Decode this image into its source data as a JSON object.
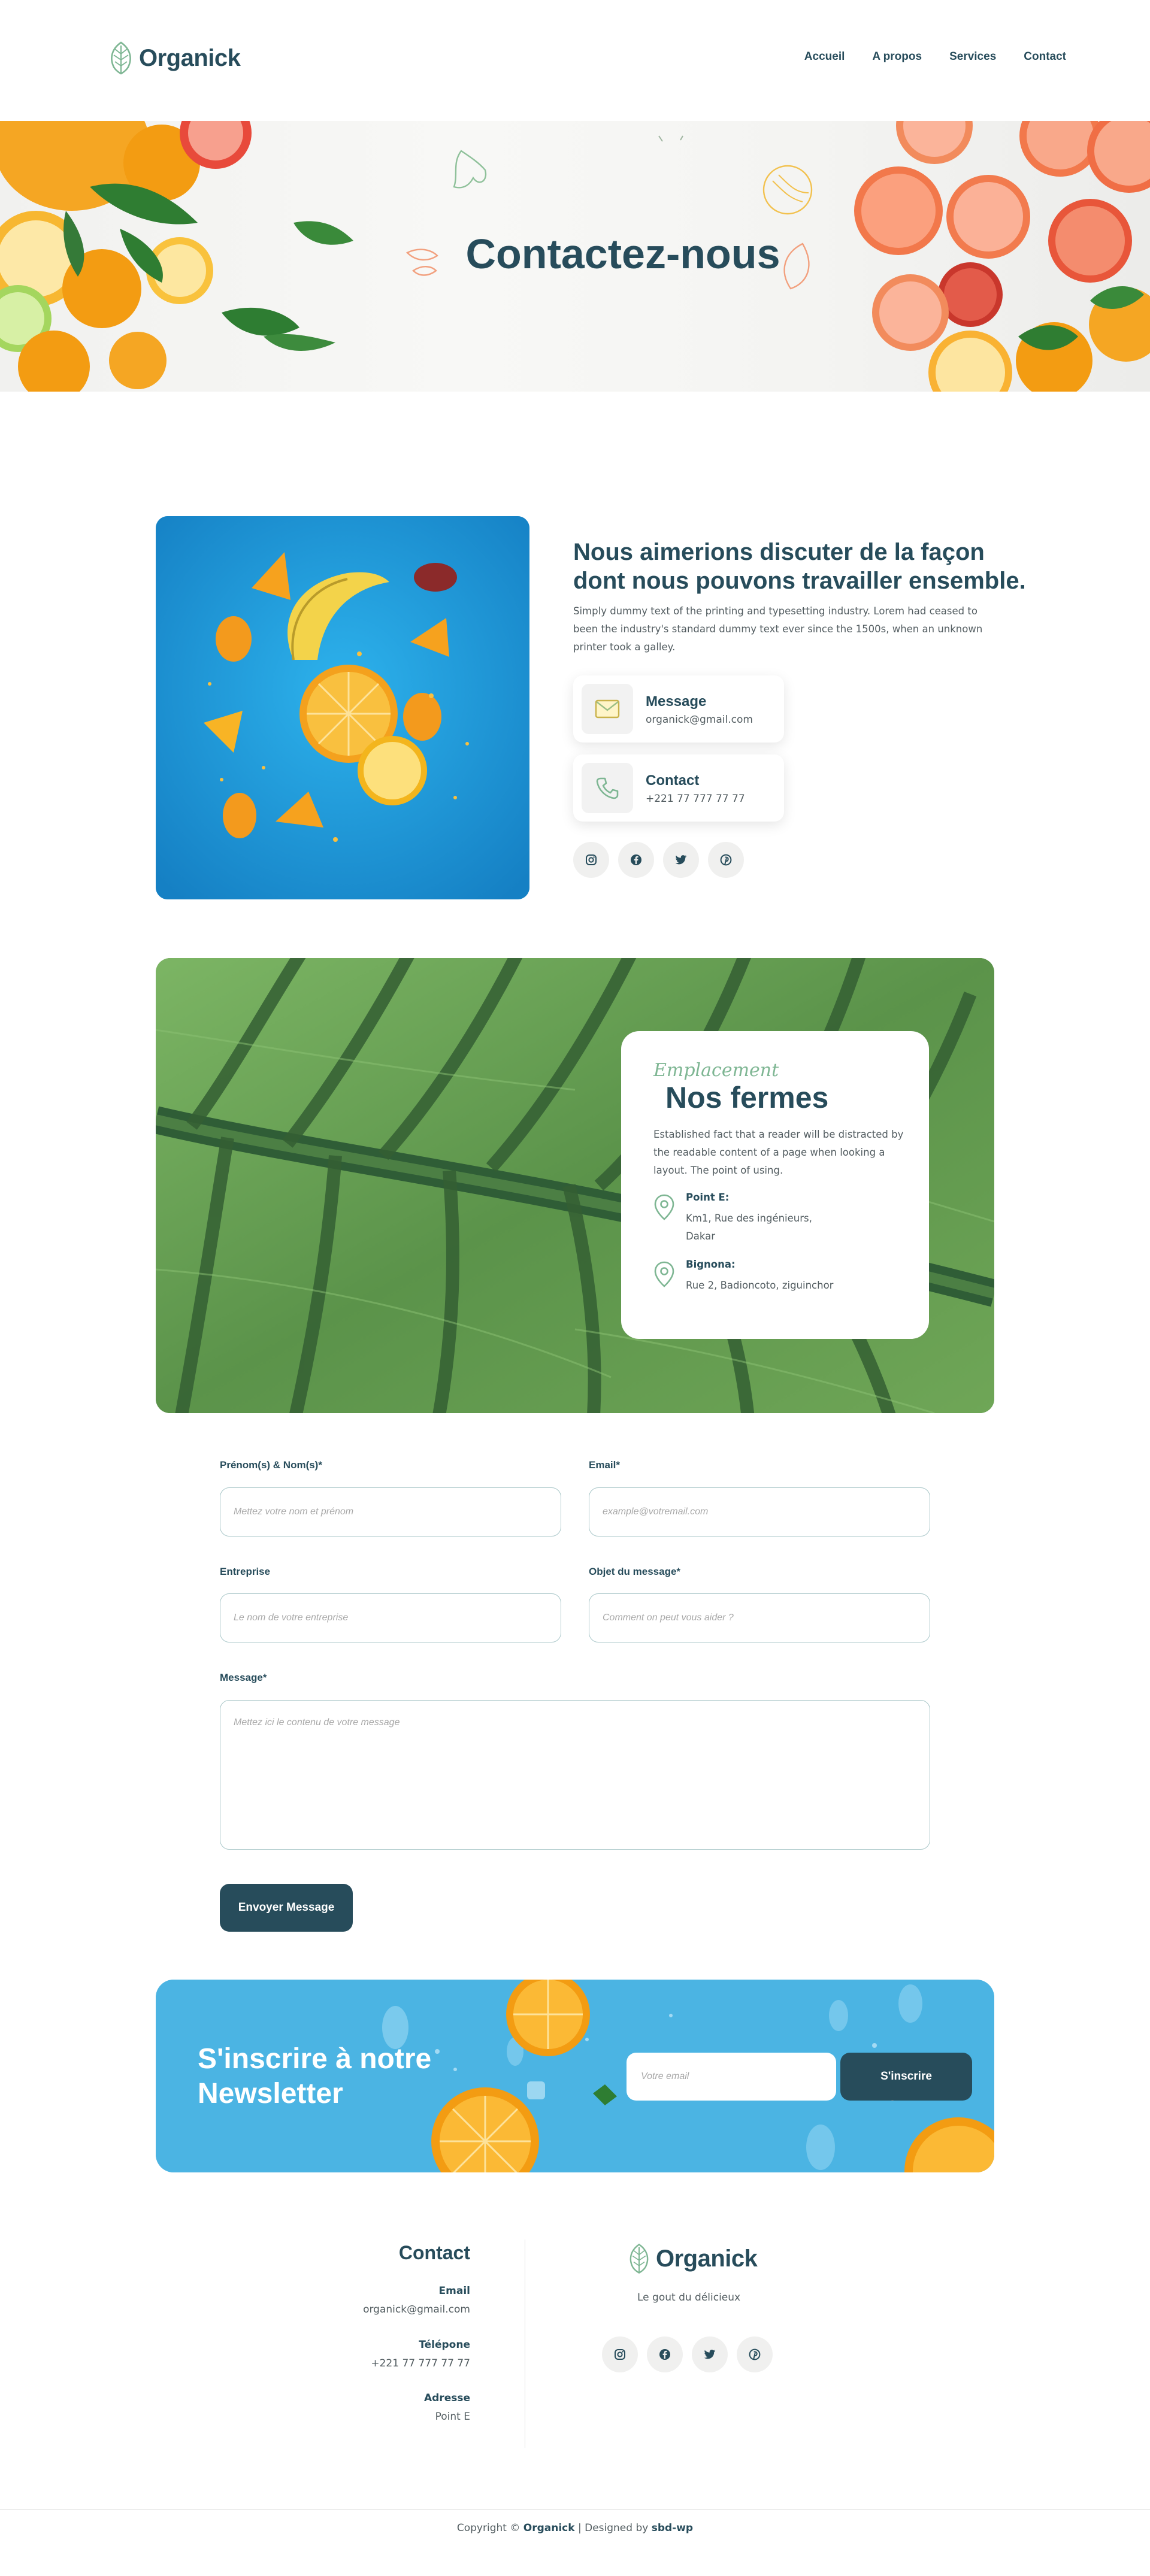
{
  "brand": {
    "name": "Organick",
    "tagline": "Le gout du délicieux"
  },
  "nav": {
    "items": [
      "Accueil",
      "A propos",
      "Services",
      "Contact"
    ]
  },
  "hero": {
    "title": "Contactez-nous"
  },
  "about": {
    "title": "Nous aimerions discuter de la façon dont nous pouvons travailler ensemble.",
    "text": "Simply dummy text of the printing and typesetting industry. Lorem had ceased to been the industry's standard dummy text ever since the 1500s, when an unknown printer took a galley.",
    "message": {
      "label": "Message",
      "value": "organick@gmail.com"
    },
    "contact": {
      "label": "Contact",
      "value": "+221 77 777 77 77"
    }
  },
  "social": {
    "icons": [
      "instagram-icon",
      "facebook-icon",
      "twitter-icon",
      "pinterest-icon"
    ]
  },
  "farms": {
    "subtitle": "Emplacement",
    "title": "Nos fermes",
    "text": "Established fact that a reader will be distracted by the readable content of a page when looking a layout. The point of using.",
    "locations": [
      {
        "name": "Point E:",
        "address": "Km1, Rue des ingénieurs, Dakar"
      },
      {
        "name": "Bignona:",
        "address": "Rue 2, Badioncoto, ziguinchor"
      }
    ]
  },
  "form": {
    "name_label": "Prénom(s) & Nom(s)*",
    "name_placeholder": "Mettez votre nom et prénom",
    "email_label": "Email*",
    "email_placeholder": "example@votremail.com",
    "company_label": "Entreprise",
    "company_placeholder": "Le nom de votre entreprise",
    "subject_label": "Objet du message*",
    "subject_placeholder": "Comment on peut vous aider ?",
    "message_label": "Message*",
    "message_placeholder": "Mettez ici le contenu de votre message",
    "submit_label": "Envoyer Message"
  },
  "newsletter": {
    "title": "S'inscrire à notre Newsletter",
    "placeholder": "Votre email",
    "button_label": "S'inscrire"
  },
  "footer": {
    "contact_title": "Contact",
    "email_label": "Email",
    "email_value": "organick@gmail.com",
    "phone_label": "Télépone",
    "phone_value": "+221 77 777 77 77",
    "address_label": "Adresse",
    "address_value": "Point E",
    "copyright_prefix": "Copyright ©",
    "copyright_brand": "Organick",
    "copyright_sep": "| Designed by",
    "copyright_designer": "sbd-wp"
  },
  "colors": {
    "primary": "#274c5b",
    "accent": "#7eb693",
    "newsletter_bg": "#4bb4e3",
    "border": "#a8c6c8"
  }
}
